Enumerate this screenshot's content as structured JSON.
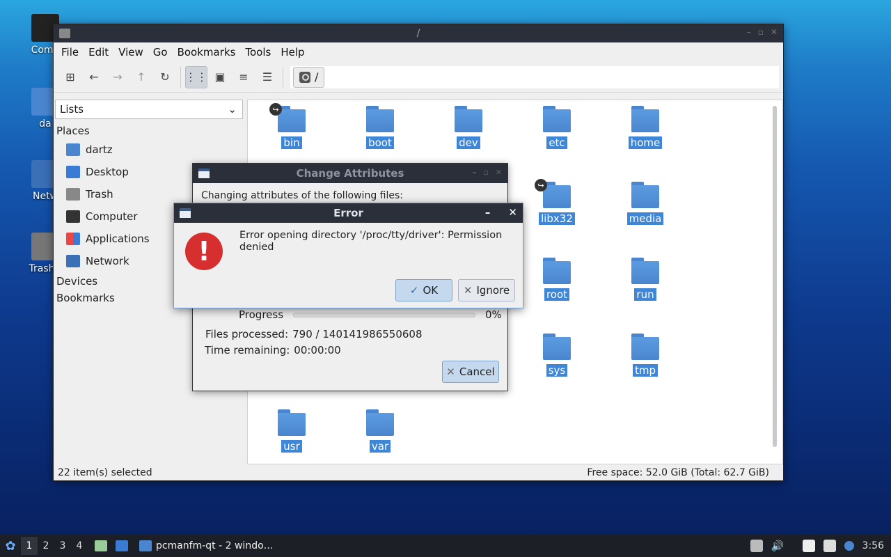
{
  "desktop": {
    "icons": [
      {
        "label": "Comp"
      },
      {
        "label": "da"
      },
      {
        "label": "Netw"
      },
      {
        "label": "Trash ("
      }
    ]
  },
  "window": {
    "title": "/",
    "menu": [
      "File",
      "Edit",
      "View",
      "Go",
      "Bookmarks",
      "Tools",
      "Help"
    ],
    "path": "/",
    "side_select": "Lists",
    "places_header": "Places",
    "places": [
      {
        "label": "dartz",
        "icon": "home-folder-icon"
      },
      {
        "label": "Desktop",
        "icon": "desktop-icon"
      },
      {
        "label": "Trash",
        "icon": "trash-icon"
      },
      {
        "label": "Computer",
        "icon": "computer-icon"
      },
      {
        "label": "Applications",
        "icon": "applications-icon"
      },
      {
        "label": "Network",
        "icon": "network-icon"
      }
    ],
    "devices_header": "Devices",
    "bookmarks_header": "Bookmarks",
    "files": [
      {
        "name": "bin",
        "link": true
      },
      {
        "name": "boot"
      },
      {
        "name": "dev"
      },
      {
        "name": "etc"
      },
      {
        "name": "home"
      },
      {
        "name": "libx32",
        "link": true
      },
      {
        "name": "media"
      },
      {
        "name": "root"
      },
      {
        "name": "run"
      },
      {
        "name": "sys"
      },
      {
        "name": "tmp"
      },
      {
        "name": "usr"
      },
      {
        "name": "var"
      }
    ],
    "status_left": "22 item(s) selected",
    "status_right": "Free space: 52.0 GiB (Total: 62.7 GiB)"
  },
  "change_attributes": {
    "title": "Change Attributes",
    "description": "Changing attributes of the following files:",
    "progress_label": "Progress",
    "progress_value": 0,
    "progress_text": "0%",
    "files_processed_label": "Files processed:",
    "files_processed_value": "790 / 140141986550608",
    "time_remaining_label": "Time remaining:",
    "time_remaining_value": "00:00:00",
    "cancel_label": "Cancel"
  },
  "error_dialog": {
    "title": "Error",
    "message": "Error opening directory '/proc/tty/driver': Permission denied",
    "ok_label": "OK",
    "ignore_label": "Ignore"
  },
  "taskbar": {
    "workspaces": [
      "1",
      "2",
      "3",
      "4"
    ],
    "current_workspace": "1",
    "task_label": "pcmanfm-qt - 2 windo…",
    "clock": "3:56"
  },
  "colors": {
    "selection": "#3d86d8",
    "folder": "#4a86cf",
    "titlebar": "#2b2f3a",
    "error_icon": "#d52f2f"
  }
}
